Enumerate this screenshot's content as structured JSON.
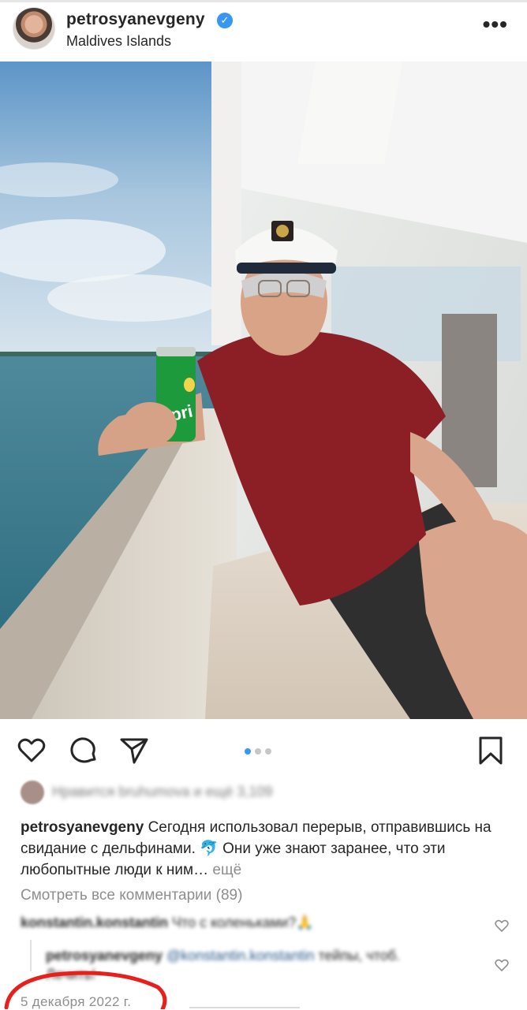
{
  "post": {
    "username": "petrosyanevgeny",
    "location": "Maldives Islands",
    "verified": true,
    "menu_icon": "more-horizontal-icon",
    "photo": {
      "can_text": "Spri",
      "carousel_total": 3,
      "carousel_active": 1
    },
    "actions": {
      "like_icon": "heart-icon",
      "comment_icon": "comment-bubble-icon",
      "share_icon": "paper-plane-icon",
      "save_icon": "bookmark-icon"
    },
    "likes_text": "Нравится bruhumova и ещё 3,109",
    "caption": {
      "username": "petrosyanevgeny",
      "text": "Сегодня использовал перерыв, отправившись на свидание с дельфинами. 🐬 Они уже знают заранее, что эти любопытные люди к ним…",
      "more_label": "ещё"
    },
    "view_all_comments": "Смотреть все комментарии (89)",
    "comments": [
      {
        "username": "konstantin.konstantin",
        "text": "Что с коленьками?🙏"
      },
      {
        "username": "petrosyanevgeny",
        "mention": "@konstantin.konstantin",
        "text": "тейпы, чтоб. Лечить!"
      }
    ],
    "date": "5 декабря 2022 г."
  },
  "colors": {
    "accent_blue": "#3897f0",
    "muted_gray": "#8e8e8e",
    "annotation_red": "#e8201b"
  }
}
